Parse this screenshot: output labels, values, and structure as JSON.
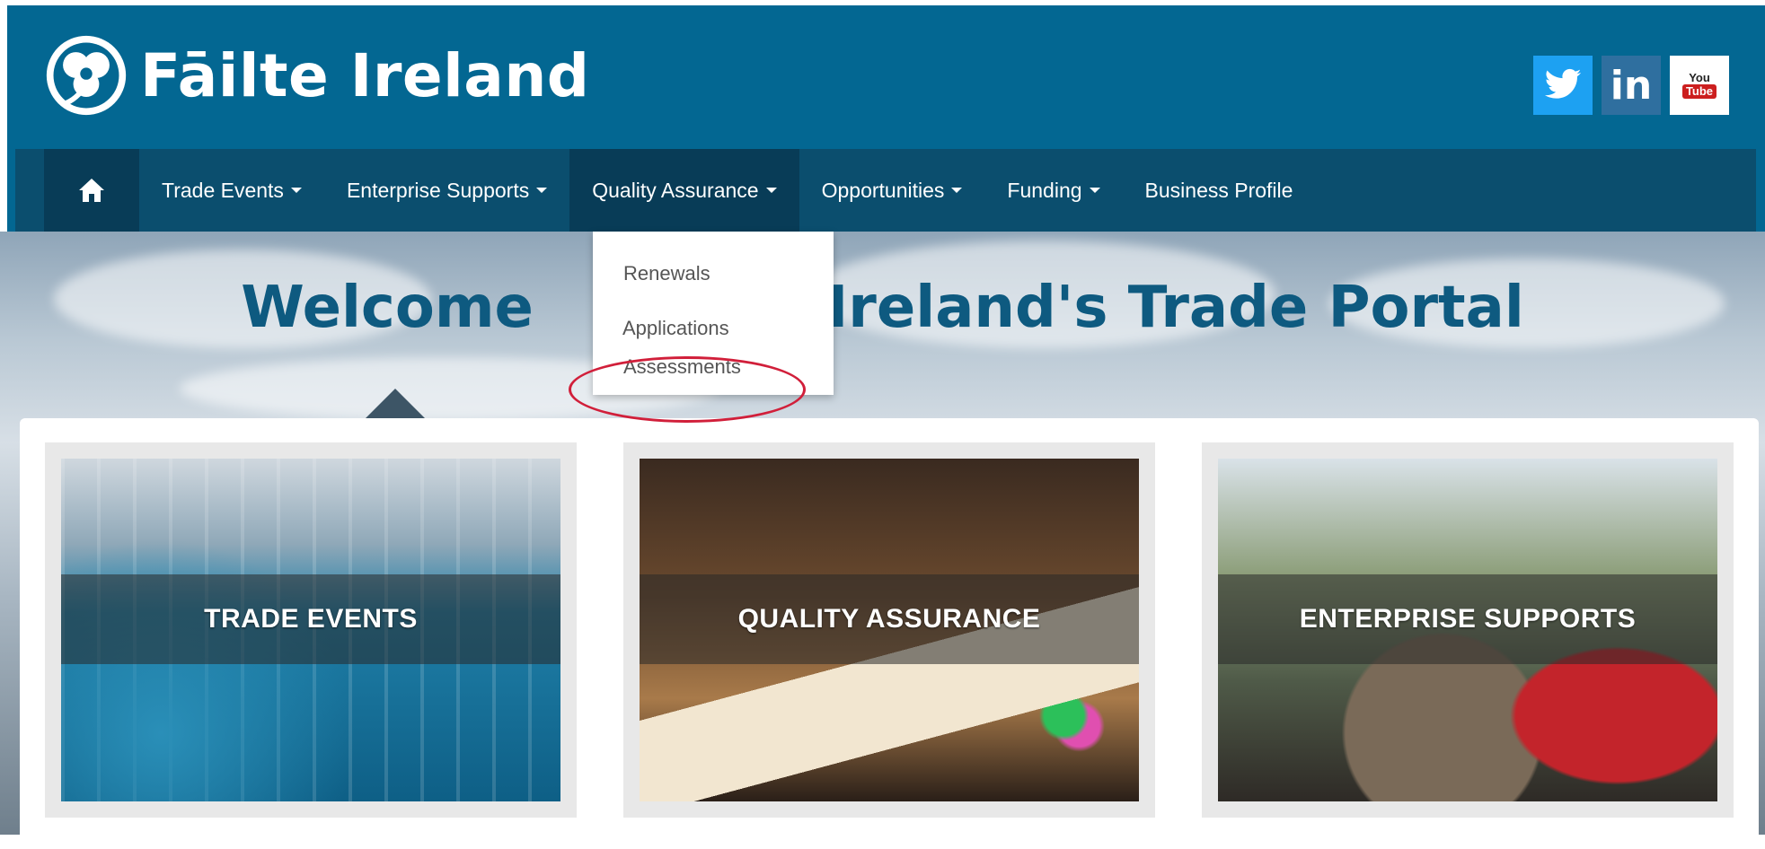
{
  "brand": {
    "name": "Fāilte Ireland",
    "primary_color": "#036792",
    "nav_color": "#0b4e6e",
    "accent_title_color": "#0e5a80"
  },
  "social": [
    {
      "name": "twitter",
      "icon": "twitter-bird-icon"
    },
    {
      "name": "linkedin",
      "label": "in",
      "icon": "linkedin-icon"
    },
    {
      "name": "youtube",
      "label_you": "You",
      "label_tube": "Tube",
      "icon": "youtube-icon"
    }
  ],
  "nav": {
    "home_icon": "home-icon",
    "items": [
      {
        "label": "Trade Events",
        "has_dropdown": true
      },
      {
        "label": "Enterprise Supports",
        "has_dropdown": true
      },
      {
        "label": "Quality Assurance",
        "has_dropdown": true,
        "active": true
      },
      {
        "label": "Opportunities",
        "has_dropdown": true
      },
      {
        "label": "Funding",
        "has_dropdown": true
      },
      {
        "label": "Business Profile",
        "has_dropdown": false
      }
    ]
  },
  "dropdown": {
    "items": [
      {
        "label": "Renewals"
      },
      {
        "label": "Applications"
      },
      {
        "label": "Assessments",
        "highlighted": true
      }
    ]
  },
  "hero": {
    "title_left": "Welcome",
    "title_right": "Ireland's Trade Portal"
  },
  "cards": [
    {
      "title": "TRADE EVENTS"
    },
    {
      "title": "QUALITY ASSURANCE"
    },
    {
      "title": "ENTERPRISE SUPPORTS"
    }
  ],
  "annotation_color": "#d11f3a"
}
